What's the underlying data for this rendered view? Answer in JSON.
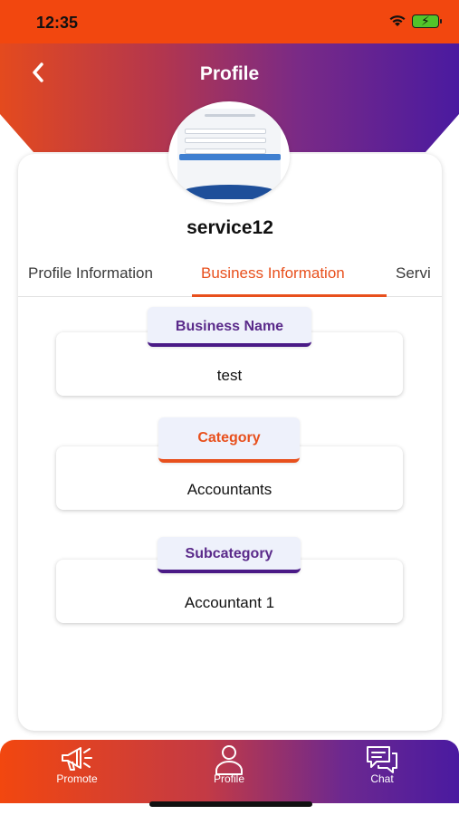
{
  "status_bar": {
    "time": "12:35"
  },
  "header": {
    "title": "Profile"
  },
  "profile": {
    "username": "service12"
  },
  "tabs": [
    {
      "label": "Profile Information",
      "active": false
    },
    {
      "label": "Business Information",
      "active": true
    },
    {
      "label": "Servi",
      "active": false
    }
  ],
  "fields": [
    {
      "label": "Business Name",
      "value": "test"
    },
    {
      "label": "Category",
      "value": "Accountants"
    },
    {
      "label": "Subcategory",
      "value": "Accountant 1"
    }
  ],
  "bottom_nav": [
    {
      "label": "Promote",
      "icon": "megaphone-icon"
    },
    {
      "label": "Profile",
      "icon": "user-icon"
    },
    {
      "label": "Chat",
      "icon": "chat-icon"
    }
  ],
  "colors": {
    "accent_orange": "#e8501d",
    "accent_purple": "#4a1aa0"
  }
}
